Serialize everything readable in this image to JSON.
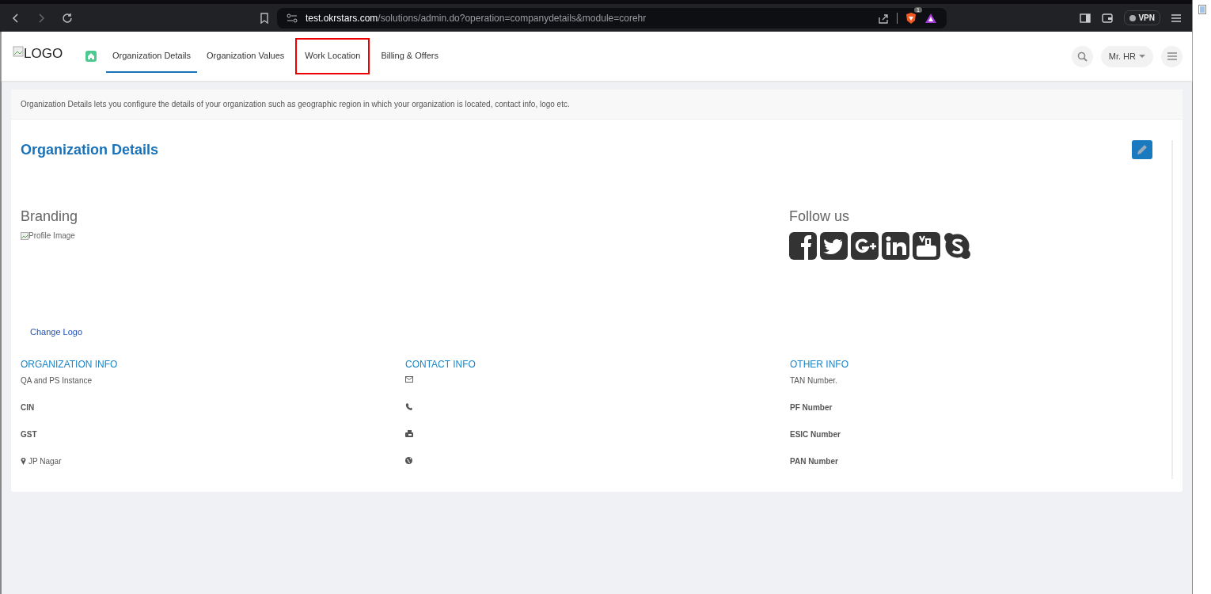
{
  "browser": {
    "url_host": "test.okrstars.com",
    "url_path": "/solutions/admin.do?operation=companydetails&module=corehr",
    "shield_badge": "1",
    "vpn_label": "VPN"
  },
  "header": {
    "logo_alt": "LOGO",
    "tabs": [
      {
        "label": "Organization Details",
        "selected": true,
        "highlighted": false
      },
      {
        "label": "Organization Values",
        "selected": false,
        "highlighted": false
      },
      {
        "label": "Work Location",
        "selected": false,
        "highlighted": true
      },
      {
        "label": "Billing & Offers",
        "selected": false,
        "highlighted": false
      }
    ],
    "user_menu": "Mr. HR"
  },
  "description": "Organization Details lets you configure the details of your organization such as geographic region in which your organization is located, contact info, logo etc.",
  "title": "Organization Details",
  "branding": {
    "heading": "Branding",
    "image_alt": "Profile Image",
    "change_logo": "Change Logo"
  },
  "follow": {
    "heading": "Follow us"
  },
  "sections": [
    {
      "heading": "ORGANIZATION INFO",
      "items": [
        {
          "kind": "text",
          "text": "QA and PS Instance",
          "bold": false
        },
        {
          "kind": "text",
          "text": "CIN",
          "bold": true
        },
        {
          "kind": "text",
          "text": "GST",
          "bold": true
        },
        {
          "kind": "location",
          "text": "JP Nagar",
          "bold": false
        }
      ]
    },
    {
      "heading": "CONTACT INFO",
      "items": [
        {
          "kind": "email"
        },
        {
          "kind": "phone"
        },
        {
          "kind": "fax"
        },
        {
          "kind": "web"
        }
      ]
    },
    {
      "heading": "OTHER INFO",
      "items": [
        {
          "kind": "text",
          "text": "TAN Number.",
          "bold": false
        },
        {
          "kind": "text",
          "text": "PF Number",
          "bold": true
        },
        {
          "kind": "text",
          "text": "ESIC Number",
          "bold": true
        },
        {
          "kind": "text",
          "text": "PAN Number",
          "bold": true
        }
      ]
    }
  ]
}
